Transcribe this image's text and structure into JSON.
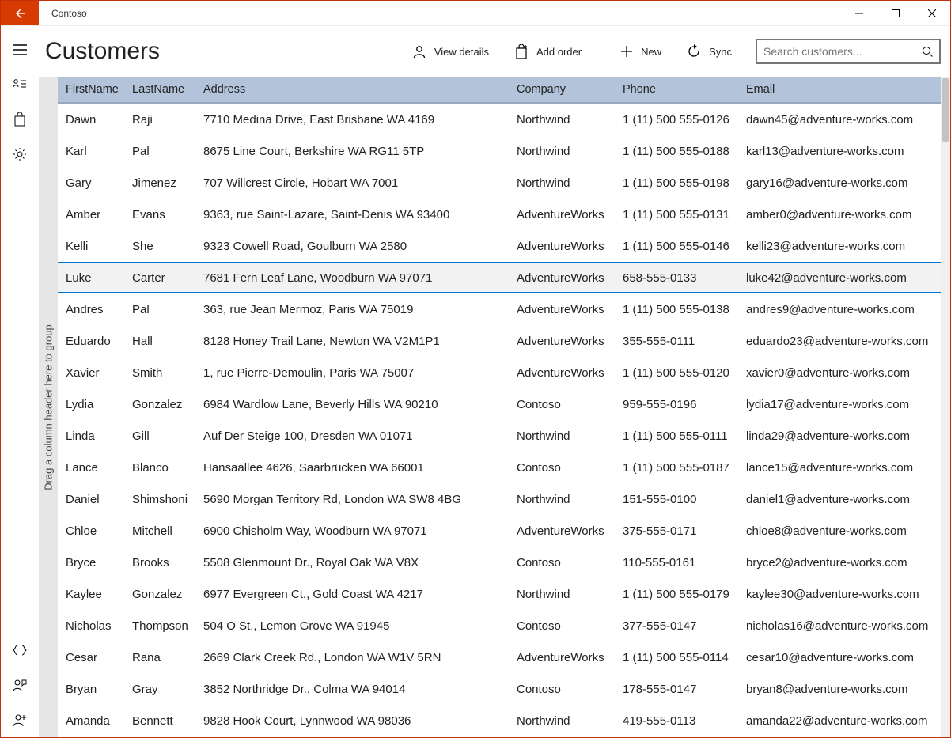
{
  "window": {
    "title": "Contoso"
  },
  "page": {
    "title": "Customers"
  },
  "commands": {
    "view_details": "View details",
    "add_order": "Add order",
    "new": "New",
    "sync": "Sync"
  },
  "search": {
    "placeholder": "Search customers..."
  },
  "grid": {
    "group_hint": "Drag a column header here to group",
    "columns": {
      "first": "FirstName",
      "last": "LastName",
      "address": "Address",
      "company": "Company",
      "phone": "Phone",
      "email": "Email"
    },
    "selected_index": 5,
    "rows": [
      {
        "first": "Dawn",
        "last": "Raji",
        "address": "7710 Medina Drive, East Brisbane WA 4169",
        "company": "Northwind",
        "phone": "1 (11) 500 555-0126",
        "email": "dawn45@adventure-works.com"
      },
      {
        "first": "Karl",
        "last": "Pal",
        "address": "8675 Line Court, Berkshire WA RG11 5TP",
        "company": "Northwind",
        "phone": "1 (11) 500 555-0188",
        "email": "karl13@adventure-works.com"
      },
      {
        "first": "Gary",
        "last": "Jimenez",
        "address": "707 Willcrest Circle, Hobart WA 7001",
        "company": "Northwind",
        "phone": "1 (11) 500 555-0198",
        "email": "gary16@adventure-works.com"
      },
      {
        "first": "Amber",
        "last": "Evans",
        "address": "9363, rue Saint-Lazare, Saint-Denis WA 93400",
        "company": "AdventureWorks",
        "phone": "1 (11) 500 555-0131",
        "email": "amber0@adventure-works.com"
      },
      {
        "first": "Kelli",
        "last": "She",
        "address": "9323 Cowell Road, Goulburn WA 2580",
        "company": "AdventureWorks",
        "phone": "1 (11) 500 555-0146",
        "email": "kelli23@adventure-works.com"
      },
      {
        "first": "Luke",
        "last": "Carter",
        "address": "7681 Fern Leaf Lane, Woodburn WA 97071",
        "company": "AdventureWorks",
        "phone": "658-555-0133",
        "email": "luke42@adventure-works.com"
      },
      {
        "first": "Andres",
        "last": "Pal",
        "address": "363, rue Jean Mermoz, Paris WA 75019",
        "company": "AdventureWorks",
        "phone": "1 (11) 500 555-0138",
        "email": "andres9@adventure-works.com"
      },
      {
        "first": "Eduardo",
        "last": "Hall",
        "address": "8128 Honey Trail Lane, Newton WA V2M1P1",
        "company": "AdventureWorks",
        "phone": "355-555-0111",
        "email": "eduardo23@adventure-works.com"
      },
      {
        "first": "Xavier",
        "last": "Smith",
        "address": "1, rue Pierre-Demoulin, Paris WA 75007",
        "company": "AdventureWorks",
        "phone": "1 (11) 500 555-0120",
        "email": "xavier0@adventure-works.com"
      },
      {
        "first": "Lydia",
        "last": "Gonzalez",
        "address": "6984 Wardlow Lane, Beverly Hills WA 90210",
        "company": "Contoso",
        "phone": "959-555-0196",
        "email": "lydia17@adventure-works.com"
      },
      {
        "first": "Linda",
        "last": "Gill",
        "address": "Auf Der Steige 100, Dresden WA 01071",
        "company": "Northwind",
        "phone": "1 (11) 500 555-0111",
        "email": "linda29@adventure-works.com"
      },
      {
        "first": "Lance",
        "last": "Blanco",
        "address": "Hansaallee 4626, Saarbrücken WA 66001",
        "company": "Contoso",
        "phone": "1 (11) 500 555-0187",
        "email": "lance15@adventure-works.com"
      },
      {
        "first": "Daniel",
        "last": "Shimshoni",
        "address": "5690 Morgan Territory Rd, London WA SW8 4BG",
        "company": "Northwind",
        "phone": "151-555-0100",
        "email": "daniel1@adventure-works.com"
      },
      {
        "first": "Chloe",
        "last": "Mitchell",
        "address": "6900 Chisholm Way, Woodburn WA 97071",
        "company": "AdventureWorks",
        "phone": "375-555-0171",
        "email": "chloe8@adventure-works.com"
      },
      {
        "first": "Bryce",
        "last": "Brooks",
        "address": "5508 Glenmount Dr., Royal Oak WA V8X",
        "company": "Contoso",
        "phone": "110-555-0161",
        "email": "bryce2@adventure-works.com"
      },
      {
        "first": "Kaylee",
        "last": "Gonzalez",
        "address": "6977 Evergreen Ct., Gold Coast WA 4217",
        "company": "Northwind",
        "phone": "1 (11) 500 555-0179",
        "email": "kaylee30@adventure-works.com"
      },
      {
        "first": "Nicholas",
        "last": "Thompson",
        "address": "504 O St., Lemon Grove WA 91945",
        "company": "Contoso",
        "phone": "377-555-0147",
        "email": "nicholas16@adventure-works.com"
      },
      {
        "first": "Cesar",
        "last": "Rana",
        "address": "2669 Clark Creek Rd., London WA W1V 5RN",
        "company": "AdventureWorks",
        "phone": "1 (11) 500 555-0114",
        "email": "cesar10@adventure-works.com"
      },
      {
        "first": "Bryan",
        "last": "Gray",
        "address": "3852 Northridge Dr., Colma WA 94014",
        "company": "Contoso",
        "phone": "178-555-0147",
        "email": "bryan8@adventure-works.com"
      },
      {
        "first": "Amanda",
        "last": "Bennett",
        "address": "9828 Hook Court, Lynnwood WA 98036",
        "company": "Northwind",
        "phone": "419-555-0113",
        "email": "amanda22@adventure-works.com"
      }
    ]
  }
}
